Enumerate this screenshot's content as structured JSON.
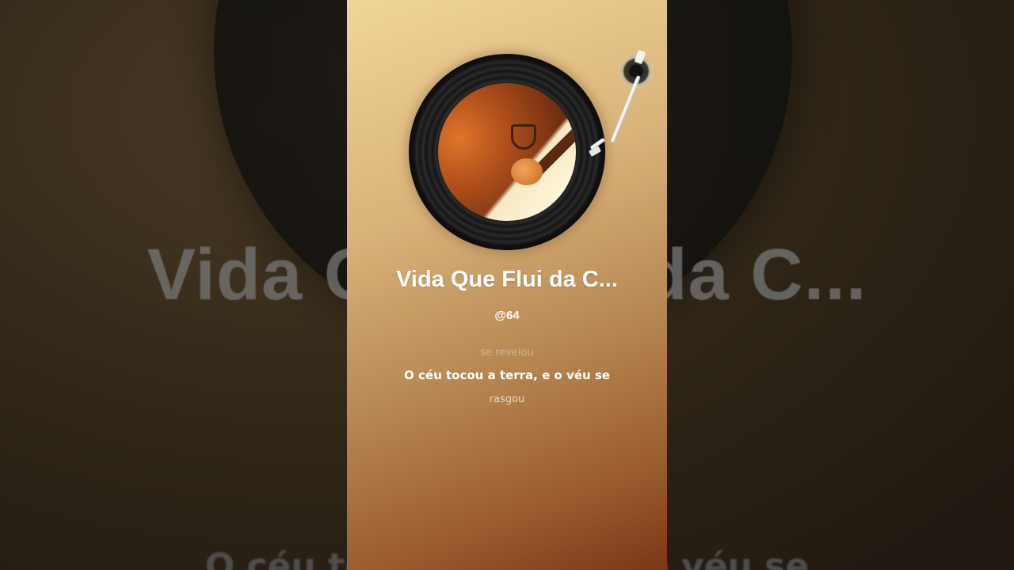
{
  "player": {
    "title": "Vida Que Flui da C...",
    "artist": "@64",
    "artwork_icon": "vinyl-record-icon",
    "tonearm_icon": "tonearm-icon"
  },
  "lyrics": {
    "previous": "se revelou",
    "current": "O céu tocou a terra, e o véu se",
    "next": "rasgou"
  },
  "background": {
    "title_echo": "Vida Que Flui da C...",
    "lyric_echo": "O céu tocou a terra, e o véu se"
  },
  "colors": {
    "panel_top": "#f0d598",
    "panel_bottom": "#7a3716",
    "text": "#ffffff"
  }
}
